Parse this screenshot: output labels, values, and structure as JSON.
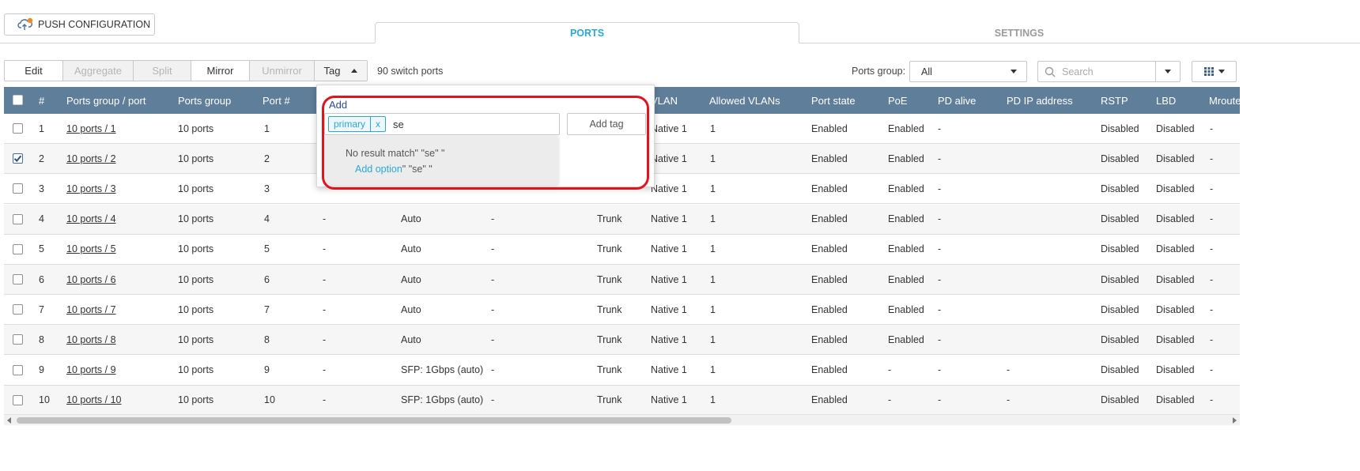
{
  "header": {
    "push_label": "PUSH CONFIGURATION",
    "tabs": [
      {
        "label": "PORTS",
        "active": true
      },
      {
        "label": "SETTINGS",
        "active": false
      }
    ]
  },
  "toolbar": {
    "buttons": [
      {
        "label": "Edit",
        "enabled": true
      },
      {
        "label": "Aggregate",
        "enabled": false
      },
      {
        "label": "Split",
        "enabled": false
      },
      {
        "label": "Mirror",
        "enabled": true
      },
      {
        "label": "Unmirror",
        "enabled": false
      },
      {
        "label": "Tag",
        "enabled": true
      }
    ],
    "switch_count": "90 switch ports",
    "ports_group_label": "Ports group:",
    "ports_group_value": "All",
    "search_placeholder": "Search"
  },
  "table": {
    "headers": [
      "#",
      "Ports group / port",
      "Ports group",
      "Port #",
      "VLAN",
      "Allowed VLANs",
      "Port state",
      "PoE",
      "PD alive",
      "PD IP address",
      "RSTP",
      "LBD",
      "Mrouter"
    ],
    "rows": [
      {
        "num": "1",
        "port": "10 ports / 1",
        "group": "10 ports",
        "port_no": "1",
        "col5": "",
        "col6": "",
        "col7": "",
        "col8": "",
        "vlan": "Native 1",
        "allowed": "1",
        "state": "Enabled",
        "poe": "Enabled",
        "pd_alive": "-",
        "pd_ip": "",
        "rstp": "Disabled",
        "lbd": "Disabled",
        "mrouter": "-",
        "checked": false
      },
      {
        "num": "2",
        "port": "10 ports / 2",
        "group": "10 ports",
        "port_no": "2",
        "col5": "",
        "col6": "",
        "col7": "",
        "col8": "",
        "vlan": "Native 1",
        "allowed": "1",
        "state": "Enabled",
        "poe": "Enabled",
        "pd_alive": "-",
        "pd_ip": "",
        "rstp": "Disabled",
        "lbd": "Disabled",
        "mrouter": "-",
        "checked": true
      },
      {
        "num": "3",
        "port": "10 ports / 3",
        "group": "10 ports",
        "port_no": "3",
        "col5": "",
        "col6": "",
        "col7": "",
        "col8": "",
        "vlan": "Native 1",
        "allowed": "1",
        "state": "Enabled",
        "poe": "Enabled",
        "pd_alive": "-",
        "pd_ip": "",
        "rstp": "Disabled",
        "lbd": "Disabled",
        "mrouter": "-",
        "checked": false
      },
      {
        "num": "4",
        "port": "10 ports / 4",
        "group": "10 ports",
        "port_no": "4",
        "col5": "-",
        "col6": "Auto",
        "col7": "-",
        "col8": "Trunk",
        "vlan": "Native 1",
        "allowed": "1",
        "state": "Enabled",
        "poe": "Enabled",
        "pd_alive": "-",
        "pd_ip": "",
        "rstp": "Disabled",
        "lbd": "Disabled",
        "mrouter": "-",
        "checked": false
      },
      {
        "num": "5",
        "port": "10 ports / 5",
        "group": "10 ports",
        "port_no": "5",
        "col5": "-",
        "col6": "Auto",
        "col7": "-",
        "col8": "Trunk",
        "vlan": "Native 1",
        "allowed": "1",
        "state": "Enabled",
        "poe": "Enabled",
        "pd_alive": "-",
        "pd_ip": "",
        "rstp": "Disabled",
        "lbd": "Disabled",
        "mrouter": "-",
        "checked": false
      },
      {
        "num": "6",
        "port": "10 ports / 6",
        "group": "10 ports",
        "port_no": "6",
        "col5": "-",
        "col6": "Auto",
        "col7": "-",
        "col8": "Trunk",
        "vlan": "Native 1",
        "allowed": "1",
        "state": "Enabled",
        "poe": "Enabled",
        "pd_alive": "-",
        "pd_ip": "",
        "rstp": "Disabled",
        "lbd": "Disabled",
        "mrouter": "-",
        "checked": false
      },
      {
        "num": "7",
        "port": "10 ports / 7",
        "group": "10 ports",
        "port_no": "7",
        "col5": "-",
        "col6": "Auto",
        "col7": "-",
        "col8": "Trunk",
        "vlan": "Native 1",
        "allowed": "1",
        "state": "Enabled",
        "poe": "Enabled",
        "pd_alive": "-",
        "pd_ip": "",
        "rstp": "Disabled",
        "lbd": "Disabled",
        "mrouter": "-",
        "checked": false
      },
      {
        "num": "8",
        "port": "10 ports / 8",
        "group": "10 ports",
        "port_no": "8",
        "col5": "-",
        "col6": "Auto",
        "col7": "-",
        "col8": "Trunk",
        "vlan": "Native 1",
        "allowed": "1",
        "state": "Enabled",
        "poe": "Enabled",
        "pd_alive": "-",
        "pd_ip": "",
        "rstp": "Disabled",
        "lbd": "Disabled",
        "mrouter": "-",
        "checked": false
      },
      {
        "num": "9",
        "port": "10 ports / 9",
        "group": "10 ports",
        "port_no": "9",
        "col5": "-",
        "col6": "SFP: 1Gbps (auto)",
        "col7": "-",
        "col8": "Trunk",
        "vlan": "Native 1",
        "allowed": "1",
        "state": "Enabled",
        "poe": "-",
        "pd_alive": "-",
        "pd_ip": "-",
        "rstp": "Disabled",
        "lbd": "Disabled",
        "mrouter": "-",
        "checked": false
      },
      {
        "num": "10",
        "port": "10 ports / 10",
        "group": "10 ports",
        "port_no": "10",
        "col5": "-",
        "col6": "SFP: 1Gbps (auto)",
        "col7": "-",
        "col8": "Trunk",
        "vlan": "Native 1",
        "allowed": "1",
        "state": "Enabled",
        "poe": "-",
        "pd_alive": "-",
        "pd_ip": "-",
        "rstp": "Disabled",
        "lbd": "Disabled",
        "mrouter": "-",
        "checked": false
      }
    ]
  },
  "tag_popup": {
    "title": "Add",
    "chip": "primary",
    "chip_remove": "x",
    "input_value": "se",
    "add_button": "Add tag",
    "no_match": "No result match\" \"se\" \"",
    "add_option_link": "Add option",
    "add_option_value": "\" \"se\" \""
  },
  "colors": {
    "accent": "#2aa7d6",
    "table_header": "#5f7e99",
    "highlight": "#e0141e"
  }
}
